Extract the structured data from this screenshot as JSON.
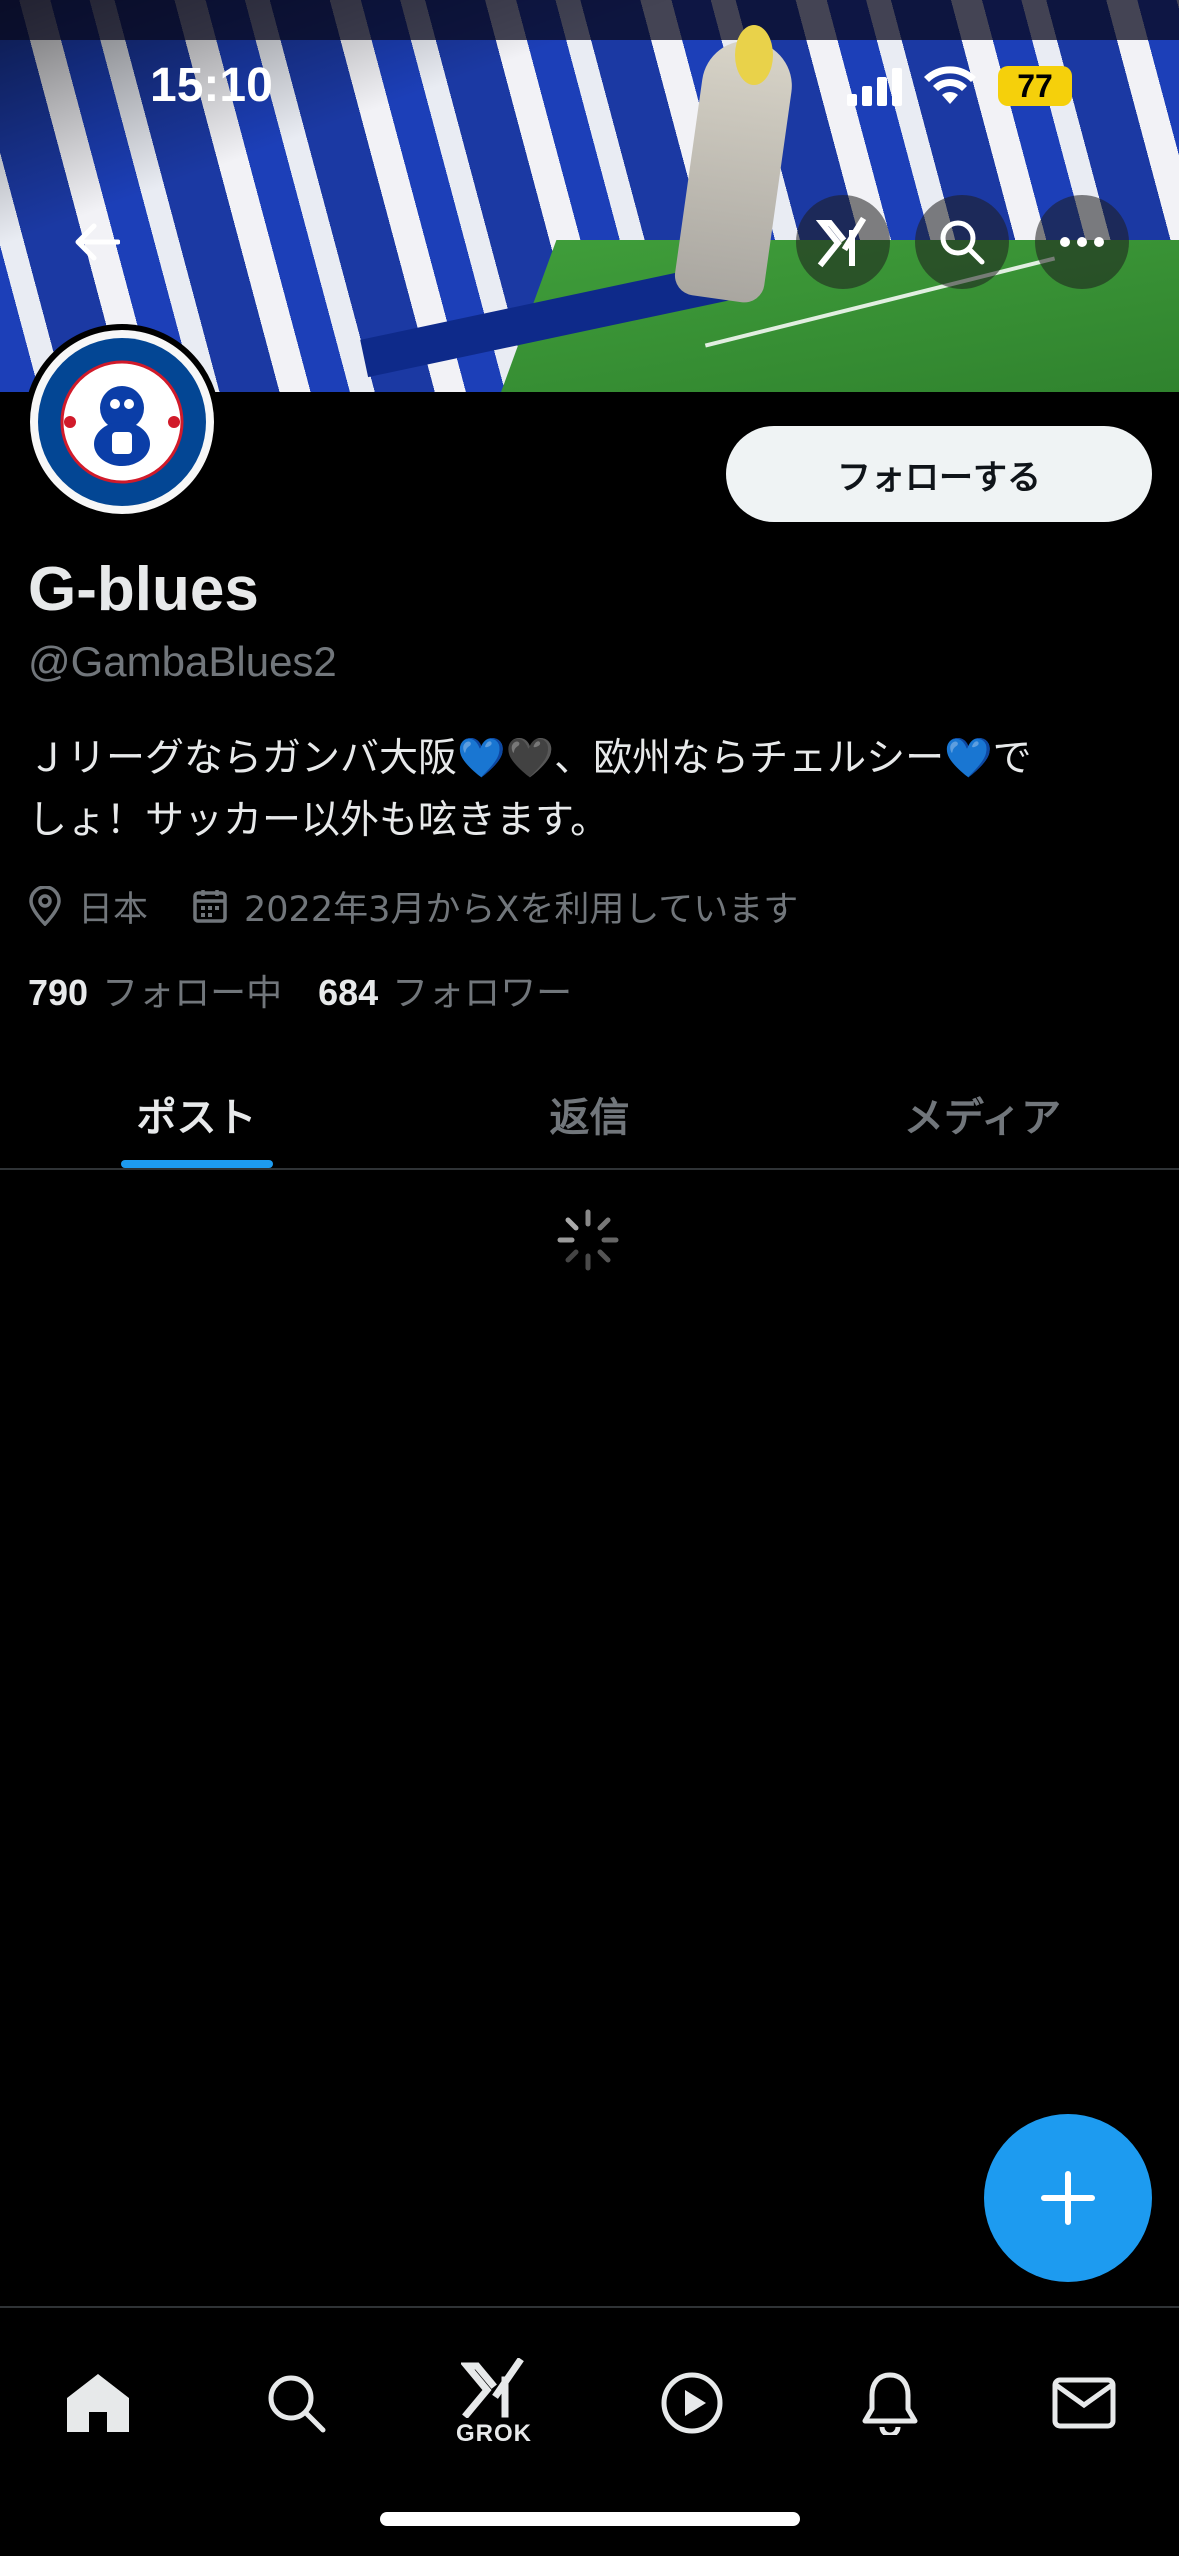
{
  "status_bar": {
    "time": "15:10",
    "battery": "77"
  },
  "profile": {
    "name": "G-blues",
    "handle": "@GambaBlues2",
    "bio_line1": "Ｊリーグならガンバ大阪💙🖤、欧州ならチェルシー💙で",
    "bio_line2": "しょ！サッカー以外も呟きます。",
    "location": "日本",
    "joined": "2022年3月からXを利用しています",
    "following_count": "790",
    "following_label": "フォロー中",
    "followers_count": "684",
    "followers_label": "フォロワー",
    "follow_button": "フォローする"
  },
  "tabs": [
    {
      "label": "ポスト",
      "active": true
    },
    {
      "label": "返信",
      "active": false
    },
    {
      "label": "メディア",
      "active": false
    }
  ],
  "bottom_nav": {
    "grok_label": "GROK"
  },
  "colors": {
    "accent": "#1d9bf0",
    "background": "#000000",
    "secondary_text": "#71767b",
    "battery": "#f5d00b"
  },
  "icons": [
    "back-arrow-icon",
    "grok-icon",
    "search-icon",
    "more-icon",
    "location-icon",
    "calendar-icon",
    "home-icon",
    "play-icon",
    "bell-icon",
    "mail-icon",
    "plus-icon"
  ]
}
